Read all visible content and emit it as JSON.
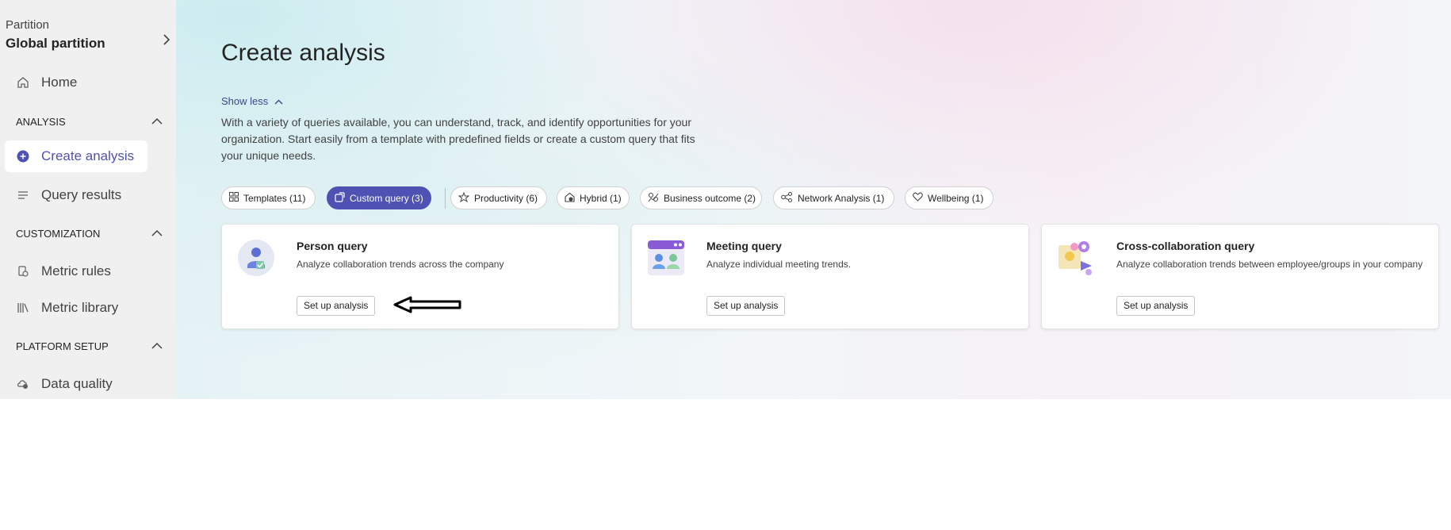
{
  "sidebar": {
    "partition_label": "Partition",
    "partition_value": "Global partition",
    "home": "Home",
    "sections": {
      "analysis": "ANALYSIS",
      "customization": "CUSTOMIZATION",
      "platform_setup": "PLATFORM SETUP"
    },
    "items": {
      "create_analysis": "Create analysis",
      "query_results": "Query results",
      "metric_rules": "Metric rules",
      "metric_library": "Metric library",
      "data_quality": "Data quality"
    }
  },
  "main": {
    "title": "Create analysis",
    "show_less": "Show less",
    "description": "With a variety of queries available, you can understand, track, and identify opportunities for your organization. Start easily from a template with predefined fields or create a custom query that fits your unique needs.",
    "filters": [
      {
        "label": "Templates (11)",
        "icon": "grid-icon",
        "selected": false
      },
      {
        "label": "Custom query (3)",
        "icon": "custom-query-icon",
        "selected": true
      },
      {
        "label": "Productivity (6)",
        "icon": "productivity-icon",
        "selected": false
      },
      {
        "label": "Hybrid (1)",
        "icon": "hybrid-icon",
        "selected": false
      },
      {
        "label": "Business outcome (2)",
        "icon": "business-outcome-icon",
        "selected": false
      },
      {
        "label": "Network Analysis (1)",
        "icon": "network-icon",
        "selected": false
      },
      {
        "label": "Wellbeing (1)",
        "icon": "heart-icon",
        "selected": false
      }
    ],
    "cards": [
      {
        "title": "Person query",
        "description": "Analyze collaboration trends across the company",
        "button": "Set up analysis"
      },
      {
        "title": "Meeting query",
        "description": "Analyze individual meeting trends.",
        "button": "Set up analysis"
      },
      {
        "title": "Cross-collaboration query",
        "description": "Analyze collaboration trends between employee/groups in your company",
        "button": "Set up analysis"
      }
    ]
  },
  "colors": {
    "accent": "#4f52b2",
    "link": "#3f4590",
    "sidebar_bg": "#f0f0f0"
  }
}
